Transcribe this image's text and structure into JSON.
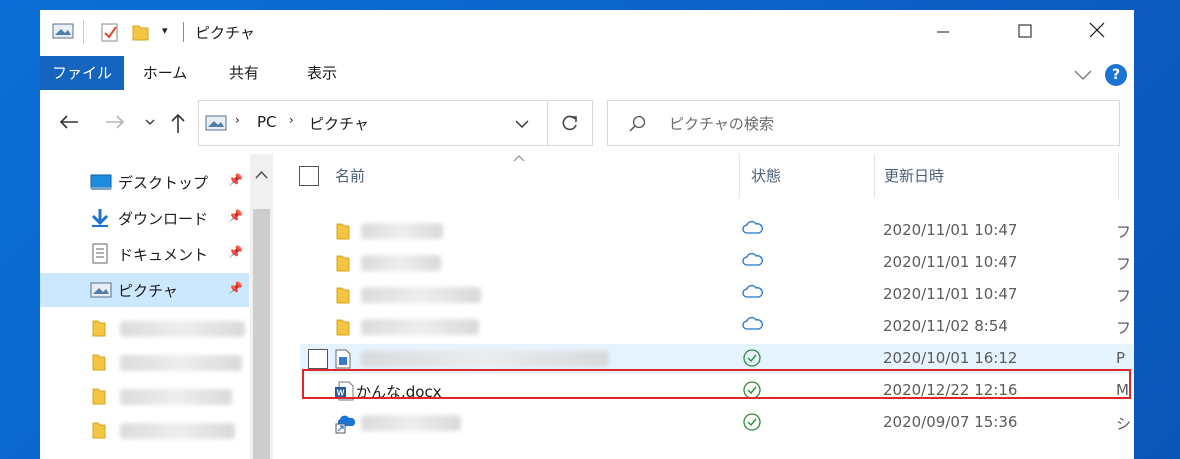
{
  "titlebar": {
    "title": "ピクチャ",
    "minimize_icon": "minimize-icon",
    "maximize_icon": "maximize-icon",
    "close_icon": "close-icon"
  },
  "ribbon": {
    "tabs": [
      {
        "label": "ファイル",
        "active": true
      },
      {
        "label": "ホーム"
      },
      {
        "label": "共有"
      },
      {
        "label": "表示"
      }
    ],
    "help_label": "?"
  },
  "address": {
    "crumbs": [
      "PC",
      "ピクチャ"
    ]
  },
  "search": {
    "placeholder": "ピクチャの検索"
  },
  "navpane": {
    "items": [
      {
        "label": "デスクトップ",
        "pinned": true,
        "icon": "desktop-icon"
      },
      {
        "label": "ダウンロード",
        "pinned": true,
        "icon": "download-icon"
      },
      {
        "label": "ドキュメント",
        "pinned": true,
        "icon": "documents-icon"
      },
      {
        "label": "ピクチャ",
        "pinned": true,
        "icon": "pictures-icon",
        "selected": true
      }
    ]
  },
  "list": {
    "columns": [
      "名前",
      "状態",
      "更新日時"
    ],
    "rows": [
      {
        "name": "",
        "status": "cloud",
        "date": "2020/11/01 10:47",
        "type_cut": "フ"
      },
      {
        "name": "",
        "status": "cloud",
        "date": "2020/11/01 10:47",
        "type_cut": "フ"
      },
      {
        "name": "",
        "status": "cloud",
        "date": "2020/11/01 10:47",
        "type_cut": "フ"
      },
      {
        "name": "",
        "status": "cloud",
        "date": "2020/11/02 8:54",
        "type_cut": "フ"
      },
      {
        "name": "",
        "status": "synced",
        "date": "2020/10/01 16:12",
        "type_cut": "P"
      },
      {
        "name": "かんな.docx",
        "status": "synced",
        "date": "2020/12/22 12:16",
        "type_cut": "M"
      },
      {
        "name": "",
        "status": "synced",
        "date": "2020/09/07 15:36",
        "type_cut": "シ"
      }
    ]
  },
  "colors": {
    "accent": "#1565c0",
    "highlight_box": "#e0262d",
    "selected_nav": "#cce8ff",
    "hover_row": "#e5f3ff"
  }
}
